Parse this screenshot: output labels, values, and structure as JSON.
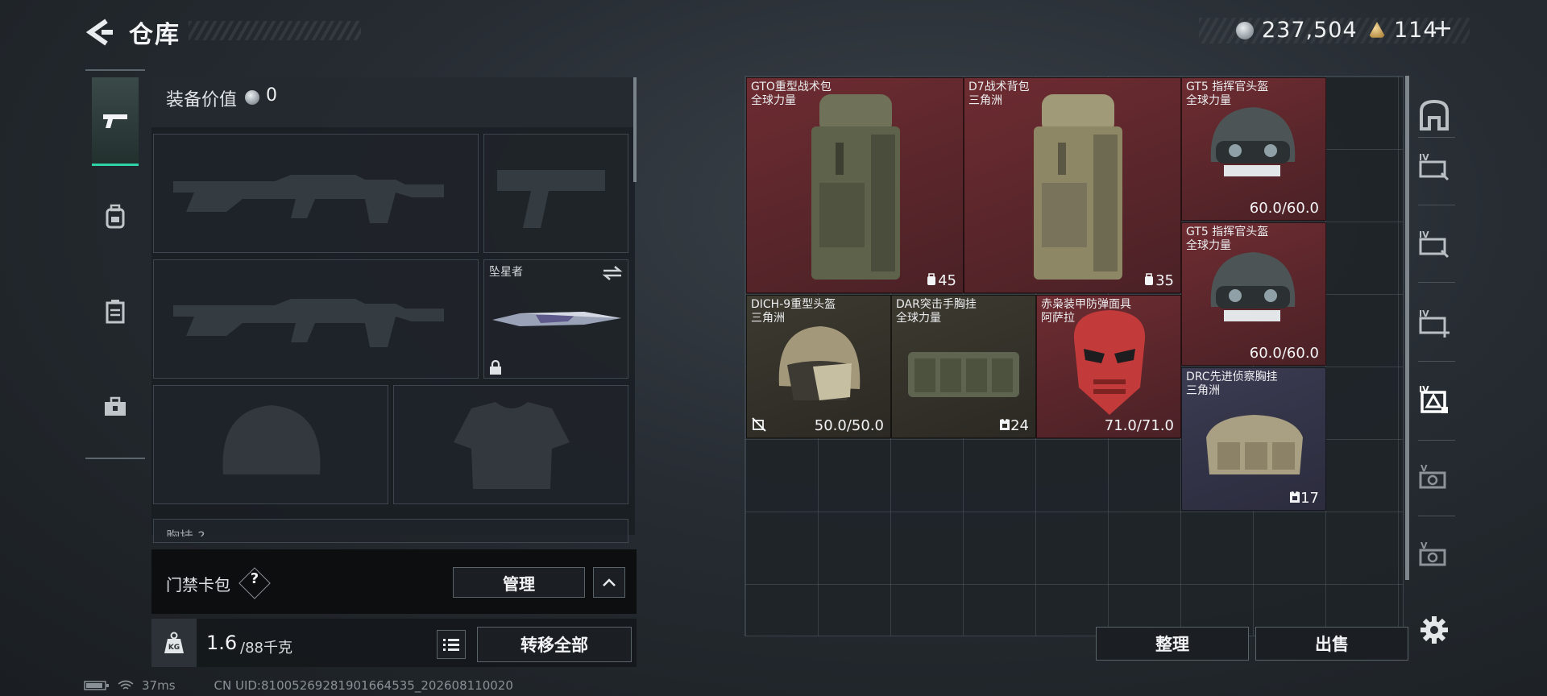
{
  "header": {
    "title": "仓库",
    "currencies": [
      {
        "icon": "silver-coin-icon",
        "value": "237,504"
      },
      {
        "icon": "gold-triangle-icon",
        "value": "114",
        "suffix": "+"
      }
    ]
  },
  "tabs": [
    {
      "icon": "pistol-icon",
      "active": true
    },
    {
      "icon": "backpack-icon",
      "active": false
    },
    {
      "icon": "locker-icon",
      "active": false
    },
    {
      "icon": "toolbox-icon",
      "active": false
    }
  ],
  "loadout": {
    "equipment_value_label": "装备价值",
    "equipment_value": "0",
    "melee_slot_label": "坠星者",
    "chest_rig_label": "胸挂 ?",
    "keycard_label": "门禁卡包",
    "keycard_help": "?",
    "manage_label": "管理",
    "weight_current": "1.6",
    "weight_max": "/88千克",
    "weight_icon_text": "KG",
    "transfer_all_label": "转移全部"
  },
  "stash": {
    "items": [
      {
        "name": "GTO重型战术包",
        "region": "全球力量",
        "stat": "45",
        "stat_icon": "capacity-icon",
        "rarity": "red"
      },
      {
        "name": "D7战术背包",
        "region": "三角洲",
        "stat": "35",
        "stat_icon": "capacity-icon",
        "rarity": "red"
      },
      {
        "name": "GT5 指挥官头盔",
        "region": "全球力量",
        "stat": "60.0/60.0",
        "rarity": "red"
      },
      {
        "name": "GT5 指挥官头盔",
        "region": "全球力量",
        "stat": "60.0/60.0",
        "rarity": "red"
      },
      {
        "name": "DICH-9重型头盔",
        "region": "三角洲",
        "stat": "50.0/50.0",
        "stat_icon": "no-repair-icon",
        "rarity": "brown"
      },
      {
        "name": "DAR突击手胸挂",
        "region": "全球力量",
        "stat": "24",
        "stat_icon": "vest-capacity-icon",
        "rarity": "brown"
      },
      {
        "name": "赤枭装甲防弹面具",
        "region": "阿萨拉",
        "stat": "71.0/71.0",
        "rarity": "red"
      },
      {
        "name": "DRC先进侦察胸挂",
        "region": "三角洲",
        "stat": "17",
        "stat_icon": "vest-capacity-icon",
        "rarity": "purple"
      }
    ],
    "sort_label": "整理",
    "sell_label": "出售"
  },
  "right_rail": [
    {
      "icon": "stash-home-icon"
    },
    {
      "icon": "container-iv-icon-1"
    },
    {
      "icon": "container-iv-icon-2"
    },
    {
      "icon": "container-iv-add-icon"
    },
    {
      "icon": "container-iv-selected-icon"
    },
    {
      "icon": "container-v-icon-1"
    },
    {
      "icon": "container-v-icon-2"
    },
    {
      "icon": "settings-gear-icon"
    }
  ],
  "status": {
    "ping": "37ms",
    "uid": "CN UID:81005269281901664535_202608110020"
  }
}
